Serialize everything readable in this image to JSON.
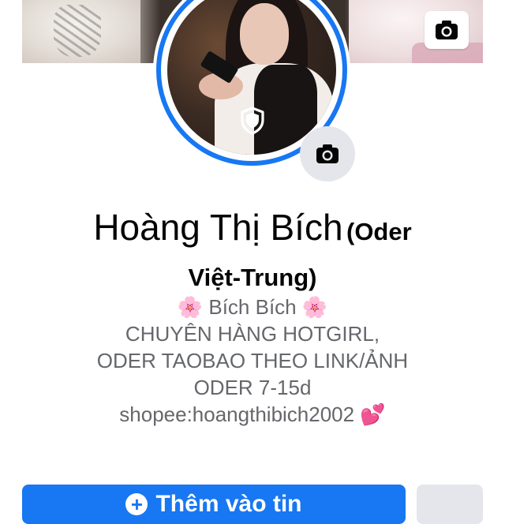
{
  "profile": {
    "name": "Hoàng Thị Bích",
    "name_suffix_line1": "(Oder",
    "name_suffix_line2": "Việt-Trung)"
  },
  "bio": {
    "nickname": "Bích Bích",
    "line1": "CHUYÊN HÀNG HOTGIRL,",
    "line2": "ODER TAOBAO THEO LINK/ẢNH",
    "line3": "ODER 7-15d",
    "line4": "shopee:hoangthibich2002",
    "flower_emoji": "🌸",
    "hearts_emoji": "💕"
  },
  "icons": {
    "cover_camera": "camera-icon",
    "avatar_camera": "camera-icon",
    "avatar_guard": "shield-icon",
    "add_story": "plus-circle-icon"
  },
  "actions": {
    "primary_label": "Thêm vào tin"
  },
  "colors": {
    "accent": "#1877f2",
    "secondary_button": "#e4e6eb",
    "text_primary": "#050505",
    "text_secondary": "#65676b"
  }
}
